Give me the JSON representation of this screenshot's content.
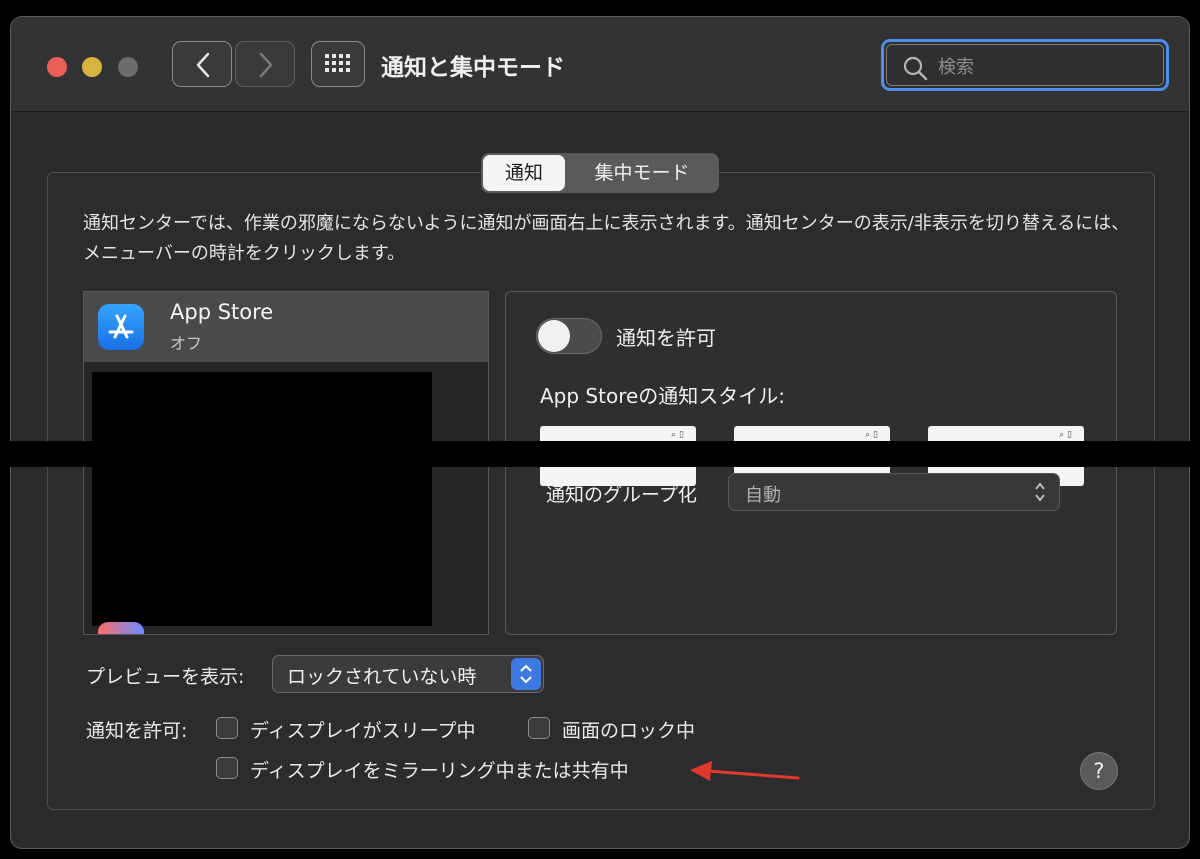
{
  "window": {
    "title": "通知と集中モード",
    "search_placeholder": "検索"
  },
  "tabs": [
    {
      "label": "通知",
      "selected": true
    },
    {
      "label": "集中モード",
      "selected": false
    }
  ],
  "description": "通知センターでは、作業の邪魔にならないように通知が画面右上に表示されます。通知センターの表示/非表示を切り替えるには、メニューバーの時計をクリックします。",
  "app_list": [
    {
      "name": "App Store",
      "status": "オフ",
      "selected": true
    }
  ],
  "detail": {
    "allow_label": "通知を許可",
    "allow_enabled": false,
    "style_label": "App Storeの通知スタイル:",
    "group_label": "通知のグループ化",
    "group_value": "自動"
  },
  "preview": {
    "label": "プレビューを表示:",
    "value": "ロックされていない時"
  },
  "allow_when": {
    "label": "通知を許可:",
    "options": [
      {
        "label": "ディスプレイがスリープ中",
        "checked": false
      },
      {
        "label": "画面のロック中",
        "checked": false
      },
      {
        "label": "ディスプレイをミラーリング中または共有中",
        "checked": false
      }
    ]
  },
  "help_label": "?",
  "colors": {
    "accent": "#3d79e0",
    "search_focus": "#4d8ee8",
    "annotation_arrow": "#e0392b"
  }
}
